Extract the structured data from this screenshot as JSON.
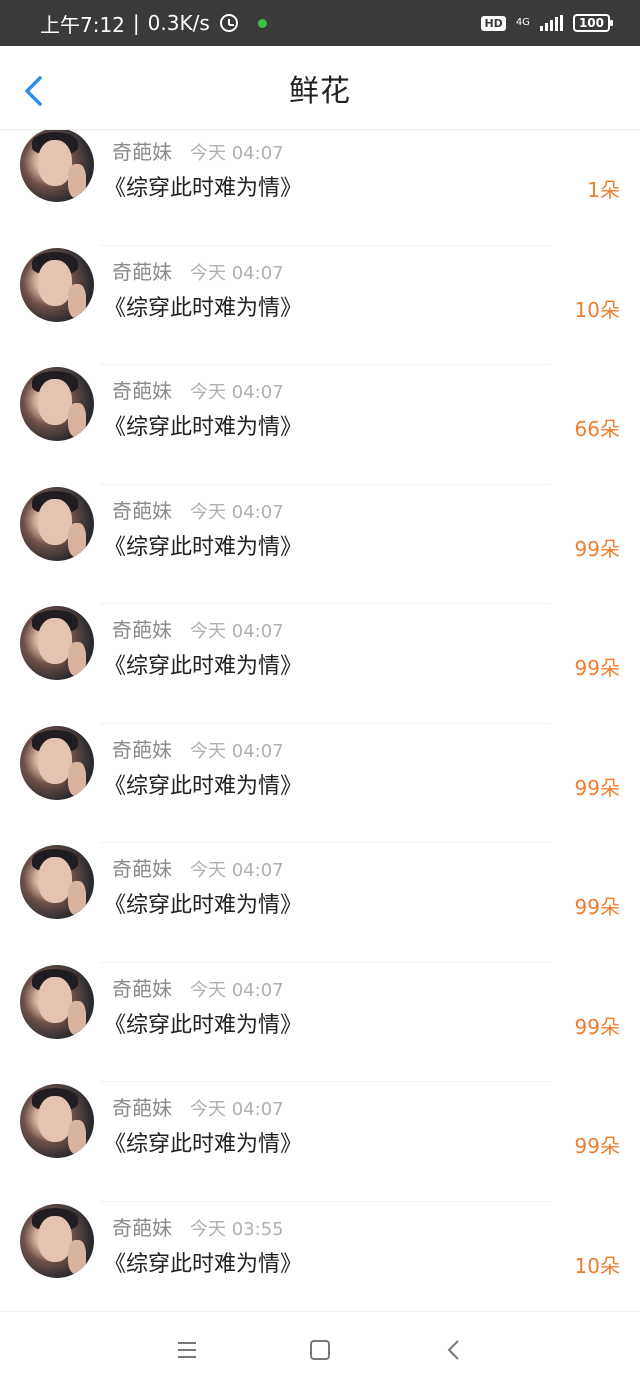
{
  "status_bar": {
    "time": "上午7:12",
    "net_speed": "0.3K/s",
    "hd": "HD",
    "network_type": "4G",
    "battery": "100"
  },
  "header": {
    "title": "鲜花"
  },
  "items": [
    {
      "name": "奇葩妹",
      "time": "今天 04:07",
      "book": "《综穿此时难为情》",
      "count": "1朵"
    },
    {
      "name": "奇葩妹",
      "time": "今天 04:07",
      "book": "《综穿此时难为情》",
      "count": "10朵"
    },
    {
      "name": "奇葩妹",
      "time": "今天 04:07",
      "book": "《综穿此时难为情》",
      "count": "66朵"
    },
    {
      "name": "奇葩妹",
      "time": "今天 04:07",
      "book": "《综穿此时难为情》",
      "count": "99朵"
    },
    {
      "name": "奇葩妹",
      "time": "今天 04:07",
      "book": "《综穿此时难为情》",
      "count": "99朵"
    },
    {
      "name": "奇葩妹",
      "time": "今天 04:07",
      "book": "《综穿此时难为情》",
      "count": "99朵"
    },
    {
      "name": "奇葩妹",
      "time": "今天 04:07",
      "book": "《综穿此时难为情》",
      "count": "99朵"
    },
    {
      "name": "奇葩妹",
      "time": "今天 04:07",
      "book": "《综穿此时难为情》",
      "count": "99朵"
    },
    {
      "name": "奇葩妹",
      "time": "今天 04:07",
      "book": "《综穿此时难为情》",
      "count": "99朵"
    },
    {
      "name": "奇葩妹",
      "time": "今天 03:55",
      "book": "《综穿此时难为情》",
      "count": "10朵"
    }
  ],
  "nav": {
    "icons": [
      "menu-icon",
      "home-square-icon",
      "back-chevron-icon"
    ]
  },
  "colors": {
    "accent": "#2e8ee8",
    "count": "#f07d30",
    "status_bar": "#3a3a3a"
  }
}
